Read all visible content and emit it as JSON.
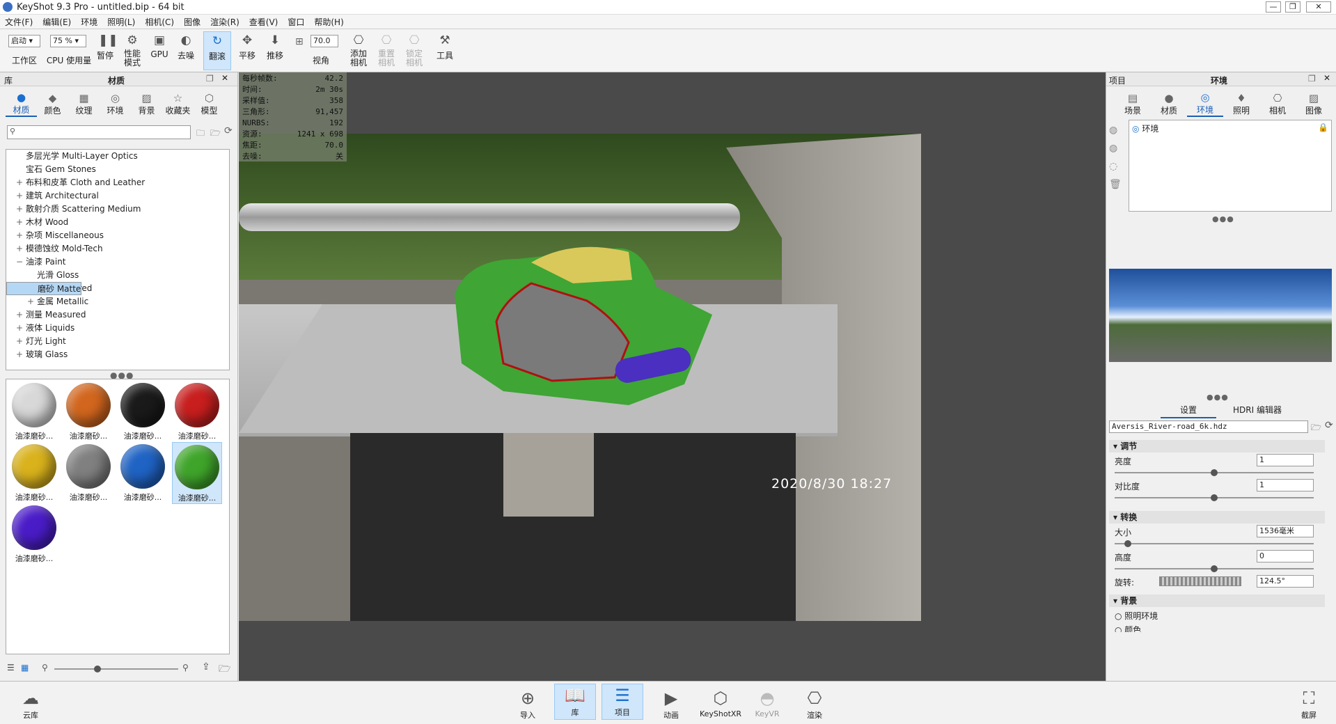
{
  "app": {
    "title": "KeyShot 9.3 Pro  - untitled.bip  - 64 bit"
  },
  "menu": [
    "文件(F)",
    "编辑(E)",
    "环境",
    "照明(L)",
    "相机(C)",
    "图像",
    "渲染(R)",
    "查看(V)",
    "窗口",
    "帮助(H)"
  ],
  "toolbar": {
    "workspace_value": "启动",
    "workspace_label": "工作区",
    "cpu_value": "75 %",
    "cpu_label": "CPU 使用量",
    "pause": "暂停",
    "perf_mode": "性能模式",
    "gpu": "GPU",
    "denoise": "去噪",
    "tumble": "翻滚",
    "pan": "平移",
    "dolly": "推移",
    "fov_value": "70.0",
    "fov_label": "视角",
    "add_camera": "添加相机",
    "reset_camera": "重置相机",
    "lock_camera": "锁定相机",
    "tools": "工具"
  },
  "library": {
    "title": "库",
    "section": "材质",
    "tabs": [
      "材质",
      "颜色",
      "纹理",
      "环境",
      "背景",
      "收藏夹",
      "模型"
    ],
    "tree": [
      {
        "label": "多层光学 Multi-Layer Optics",
        "indent": 0,
        "expander": ""
      },
      {
        "label": "宝石 Gem Stones",
        "indent": 0,
        "expander": ""
      },
      {
        "label": "布料和皮革 Cloth and Leather",
        "indent": 0,
        "expander": "+"
      },
      {
        "label": "建筑 Architectural",
        "indent": 0,
        "expander": "+"
      },
      {
        "label": "散射介质 Scattering Medium",
        "indent": 0,
        "expander": "+"
      },
      {
        "label": "木材 Wood",
        "indent": 0,
        "expander": "+"
      },
      {
        "label": "杂项 Miscellaneous",
        "indent": 0,
        "expander": "+"
      },
      {
        "label": "模德蚀纹 Mold-Tech",
        "indent": 0,
        "expander": "+"
      },
      {
        "label": "油漆 Paint",
        "indent": 0,
        "expander": "−"
      },
      {
        "label": "光滑 Gloss",
        "indent": 1,
        "expander": ""
      },
      {
        "label": "磨砂 Matte",
        "indent": 1,
        "expander": "",
        "selected": true
      },
      {
        "label": "纹理 Textured",
        "indent": 1,
        "expander": ""
      },
      {
        "label": "金属 Metallic",
        "indent": 1,
        "expander": "+"
      },
      {
        "label": "测量 Measured",
        "indent": 0,
        "expander": "+"
      },
      {
        "label": "液体 Liquids",
        "indent": 0,
        "expander": "+"
      },
      {
        "label": "灯光 Light",
        "indent": 0,
        "expander": "+"
      },
      {
        "label": "玻璃 Glass",
        "indent": 0,
        "expander": "+"
      }
    ],
    "thumbs": [
      {
        "label": "油漆磨砂...",
        "color": "#d8d8d8"
      },
      {
        "label": "油漆磨砂...",
        "color": "#d2661e"
      },
      {
        "label": "油漆磨砂...",
        "color": "#1a1a1a"
      },
      {
        "label": "油漆磨砂...",
        "color": "#c81e1e"
      },
      {
        "label": "油漆磨砂...",
        "color": "#d9b21c"
      },
      {
        "label": "油漆磨砂...",
        "color": "#808080"
      },
      {
        "label": "油漆磨砂...",
        "color": "#1f63c4"
      },
      {
        "label": "油漆磨砂...",
        "color": "#3fa52a",
        "selected": true
      },
      {
        "label": "油漆磨砂...",
        "color": "#4a1cc8"
      }
    ]
  },
  "stats": [
    {
      "k": "每秒帧数:",
      "v": "42.2"
    },
    {
      "k": "时间:",
      "v": "2m 30s"
    },
    {
      "k": "采样值:",
      "v": "358"
    },
    {
      "k": "三角形:",
      "v": "91,457"
    },
    {
      "k": "NURBS:",
      "v": "192"
    },
    {
      "k": "资源:",
      "v": "1241 x 698"
    },
    {
      "k": "焦距:",
      "v": "70.0"
    },
    {
      "k": "去噪:",
      "v": "关"
    }
  ],
  "viewport": {
    "timestamp": "2020/8/30  18:27"
  },
  "project": {
    "title": "项目",
    "section": "环境",
    "tabs": [
      "场景",
      "材质",
      "环境",
      "照明",
      "相机",
      "图像"
    ],
    "env_item": "环境",
    "subtabs": [
      "设置",
      "HDRI 编辑器"
    ],
    "hdri_file": "Aversis_River-road_6k.hdz",
    "adjust": "调节",
    "brightness_label": "亮度",
    "brightness_value": "1",
    "brightness_pct": 0.5,
    "contrast_label": "对比度",
    "contrast_value": "1",
    "contrast_pct": 0.5,
    "transform": "转换",
    "size_label": "大小",
    "size_value": "1536毫米",
    "size_pct": 0.05,
    "height_label": "高度",
    "height_value": "0",
    "height_pct": 0.5,
    "rotation_label": "旋转:",
    "rotation_value": "124.5°",
    "background": "背景",
    "bg_option1": "照明环境",
    "bg_option2": "颜色"
  },
  "bottom": {
    "cloud": "云库",
    "import": "导入",
    "library": "库",
    "project": "项目",
    "animation": "动画",
    "keyshotxr": "KeyShotXR",
    "keyvr": "KeyVR",
    "render": "渲染",
    "screenshot": "截屏"
  }
}
